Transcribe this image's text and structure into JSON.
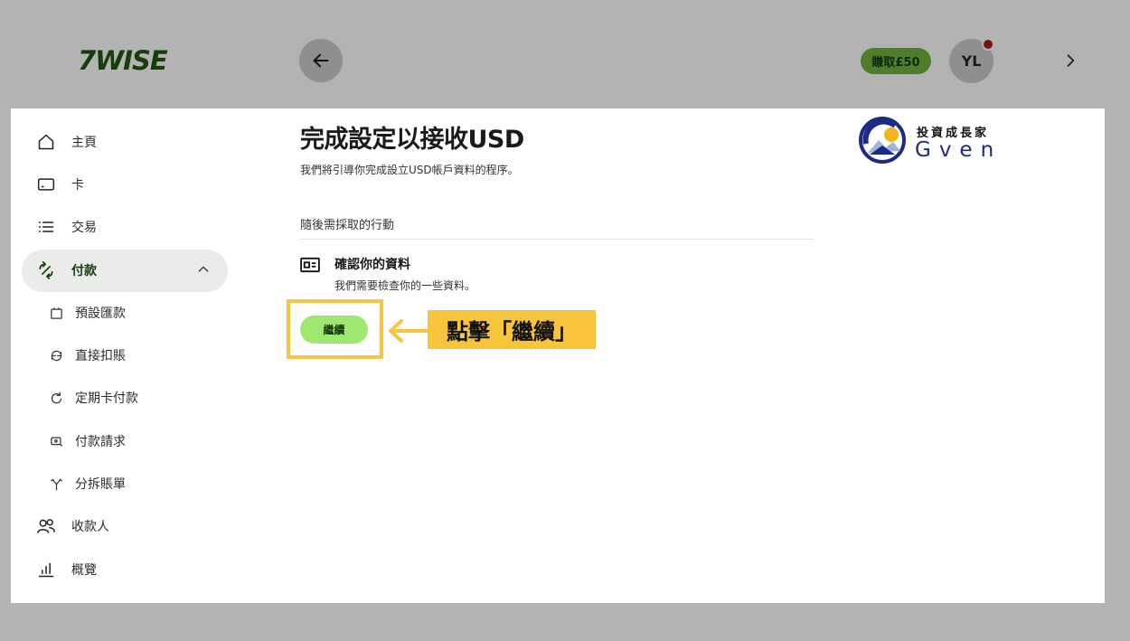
{
  "header": {
    "logo_text": "7WISE",
    "earn_label": "賺取£50",
    "avatar_initials": "YL"
  },
  "sidebar": {
    "items": [
      {
        "label": "主頁",
        "icon": "home-icon"
      },
      {
        "label": "卡",
        "icon": "card-icon"
      },
      {
        "label": "交易",
        "icon": "list-icon"
      },
      {
        "label": "付款",
        "icon": "payments-icon",
        "active": true
      },
      {
        "label": "收款人",
        "icon": "recipients-icon"
      },
      {
        "label": "概覽",
        "icon": "chart-icon"
      }
    ],
    "sub_items": [
      {
        "label": "預設匯款",
        "icon": "calendar-icon"
      },
      {
        "label": "直接扣賬",
        "icon": "refresh-icon"
      },
      {
        "label": "定期卡付款",
        "icon": "rotate-icon"
      },
      {
        "label": "付款請求",
        "icon": "request-icon"
      },
      {
        "label": "分拆賬單",
        "icon": "split-icon"
      }
    ]
  },
  "main": {
    "title": "完成設定以接收USD",
    "subtitle": "我們將引導你完成設立USD帳戶資料的程序。",
    "section_label": "隨後需採取的行動",
    "task_title": "確認你的資料",
    "task_desc": "我們需要檢查你的一些資料。",
    "continue_label": "繼續"
  },
  "annotation": {
    "callout_text": "點擊「繼續」"
  },
  "watermark": {
    "top_text": "投資成長家",
    "bottom_text": "Gven"
  },
  "colors": {
    "accent_green": "#9fe870",
    "highlight_yellow": "#f8c43c",
    "brand_dark": "#173d0d"
  }
}
